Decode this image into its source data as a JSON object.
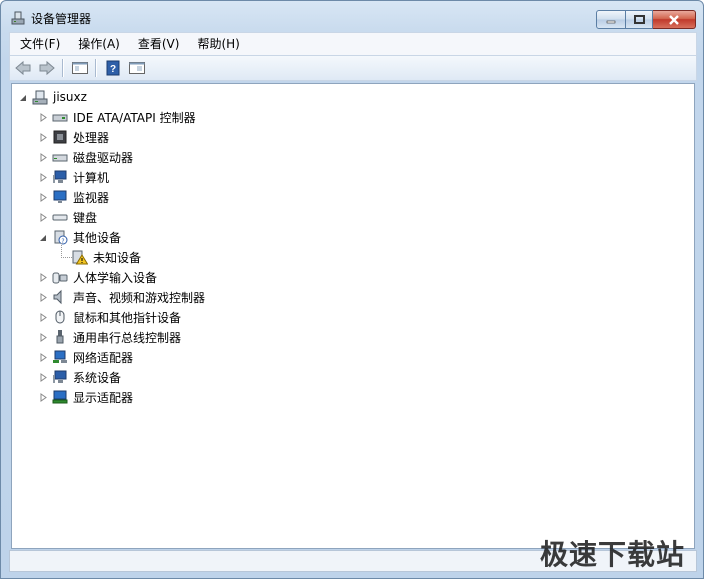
{
  "window": {
    "title": "设备管理器"
  },
  "menu": [
    {
      "label": "文件(F)"
    },
    {
      "label": "操作(A)"
    },
    {
      "label": "查看(V)"
    },
    {
      "label": "帮助(H)"
    }
  ],
  "tree": {
    "root": "jisuxz",
    "items": [
      {
        "label": "IDE ATA/ATAPI 控制器",
        "icon": "ide-controller-icon",
        "expanded": false
      },
      {
        "label": "处理器",
        "icon": "processor-icon",
        "expanded": false
      },
      {
        "label": "磁盘驱动器",
        "icon": "disk-drive-icon",
        "expanded": false
      },
      {
        "label": "计算机",
        "icon": "computer-icon",
        "expanded": false
      },
      {
        "label": "监视器",
        "icon": "monitor-icon",
        "expanded": false
      },
      {
        "label": "键盘",
        "icon": "keyboard-icon",
        "expanded": false
      },
      {
        "label": "其他设备",
        "icon": "other-devices-icon",
        "expanded": true,
        "children": [
          {
            "label": "未知设备",
            "icon": "unknown-device-warning-icon"
          }
        ]
      },
      {
        "label": "人体学输入设备",
        "icon": "hid-icon",
        "expanded": false
      },
      {
        "label": "声音、视频和游戏控制器",
        "icon": "sound-icon",
        "expanded": false
      },
      {
        "label": "鼠标和其他指针设备",
        "icon": "mouse-icon",
        "expanded": false
      },
      {
        "label": "通用串行总线控制器",
        "icon": "usb-icon",
        "expanded": false
      },
      {
        "label": "网络适配器",
        "icon": "network-adapter-icon",
        "expanded": false
      },
      {
        "label": "系统设备",
        "icon": "system-devices-icon",
        "expanded": false
      },
      {
        "label": "显示适配器",
        "icon": "display-adapter-icon",
        "expanded": false
      }
    ]
  },
  "watermark": "极速下载站"
}
